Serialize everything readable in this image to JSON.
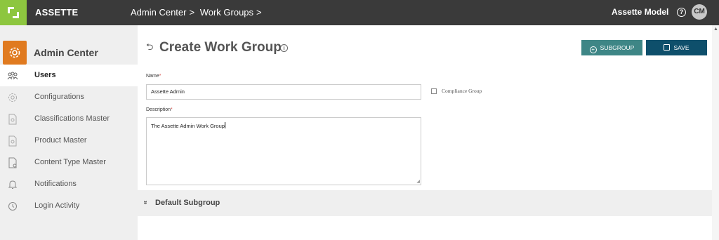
{
  "app": {
    "brand": "ASSETTE",
    "model": "Assette Model",
    "avatar_initials": "CM",
    "logo_color": "#8dc63f"
  },
  "breadcrumb": [
    "Admin Center",
    ">",
    "Work Groups",
    ">"
  ],
  "sidebar": {
    "title": "Admin Center",
    "items": [
      {
        "label": "Users",
        "icon": "users-icon",
        "active": true
      },
      {
        "label": "Configurations",
        "icon": "gear-icon"
      },
      {
        "label": "Classifications Master",
        "icon": "document-icon"
      },
      {
        "label": "Product Master",
        "icon": "document-icon"
      },
      {
        "label": "Content Type Master",
        "icon": "file-settings-icon"
      },
      {
        "label": "Notifications",
        "icon": "bell-icon"
      },
      {
        "label": "Login Activity",
        "icon": "clock-icon"
      }
    ]
  },
  "page": {
    "title": "Create Work Group"
  },
  "toolbar": {
    "subgroup_label": "SUBGROUP",
    "save_label": "SAVE",
    "subgroup_color": "#3e8686",
    "save_color": "#0e4f6b"
  },
  "form": {
    "name_label": "Name",
    "name_value": "Assette Admin",
    "required_mark": "*",
    "description_label": "Description",
    "description_value": "The Assette Admin Work Group",
    "compliance_label": "Compliance Group",
    "compliance_checked": false
  },
  "sections": [
    {
      "title": "Default Subgroup"
    }
  ]
}
